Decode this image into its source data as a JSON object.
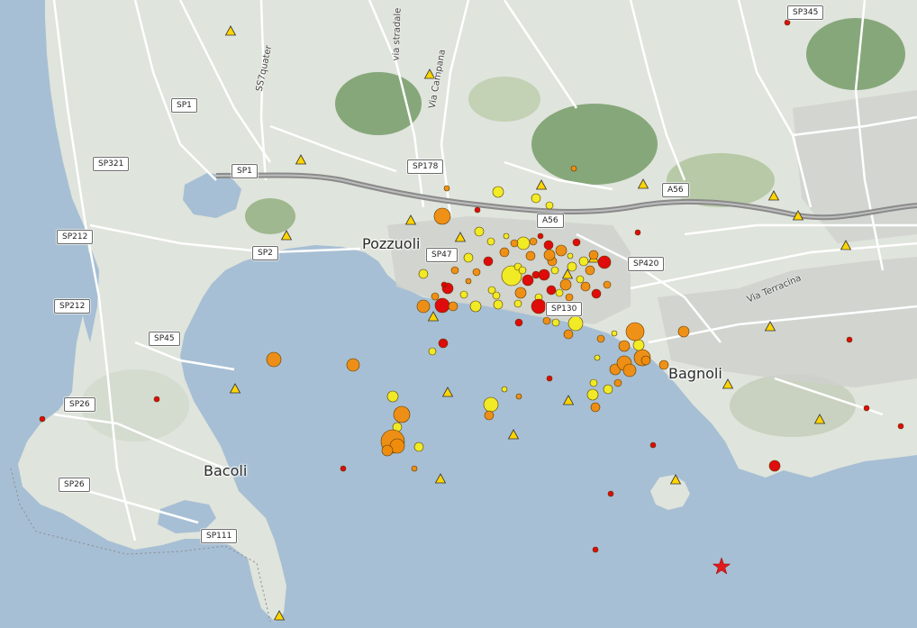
{
  "map": {
    "colors": {
      "sea": "#a7bfd4",
      "land": "#dfe4dc",
      "relief": "#b7c9a6",
      "crater": "#86a77a",
      "urban": "#cfd1cd",
      "road": "#ffffff",
      "highway": "#8a8a8a"
    },
    "places": [
      {
        "id": "pozzuoli",
        "name": "Pozzuoli"
      },
      {
        "id": "bagnoli",
        "name": "Bagnoli"
      },
      {
        "id": "bacoli",
        "name": "Bacoli"
      }
    ],
    "streets": [
      {
        "id": "ss7quater",
        "name": "SS7quater"
      },
      {
        "id": "via-campana",
        "name": "Via Campana"
      },
      {
        "id": "via-stradale",
        "name": "via stradale"
      },
      {
        "id": "via-terracina",
        "name": "Via Terracina"
      }
    ],
    "road_shields": [
      "SP1",
      "SP1",
      "SP345",
      "SP321",
      "SP178",
      "A56",
      "A56",
      "SP212",
      "SP212",
      "SP2",
      "SP47",
      "SP420",
      "SP130",
      "SP45",
      "SP26",
      "SP26",
      "SP111"
    ]
  },
  "legend_symbols": {
    "station": {
      "shape": "triangle",
      "color": "#ffd400",
      "stroke": "#333333"
    },
    "epicenter": {
      "shape": "star",
      "color": "#e31a1c"
    },
    "event_colors": {
      "red": "#e00000",
      "orange": "#f08c0c",
      "yellow": "#f2ec1b"
    }
  },
  "markers": {
    "stations": 22,
    "epicenter_star": 1,
    "events": [
      {
        "color": "red",
        "mag": 1.2
      },
      {
        "color": "orange",
        "mag": 2.4
      },
      {
        "color": "yellow",
        "mag": 3.0
      }
    ]
  }
}
